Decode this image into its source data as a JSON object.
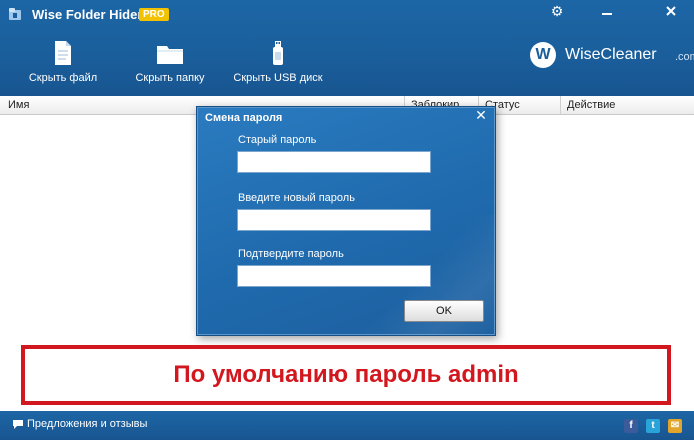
{
  "app": {
    "title": "Wise Folder Hider",
    "badge": "PRO"
  },
  "toolbar": {
    "hide_file": "Скрыть файл",
    "hide_folder": "Скрыть папку",
    "hide_usb": "Скрыть USB диск"
  },
  "brand": {
    "letter": "W",
    "name": "WiseCleaner",
    "domain": ".com"
  },
  "table": {
    "columns": [
      "Имя",
      "Заблокир.",
      "Статус",
      "Действие"
    ]
  },
  "dialog": {
    "title": "Смена пароля",
    "old_password_label": "Старый пароль",
    "old_password_value": "",
    "new_password_label": "Введите новый пароль",
    "new_password_value": "",
    "confirm_password_label": "Подтвердите пароль",
    "confirm_password_value": "",
    "ok_label": "OK",
    "close_glyph": "✕"
  },
  "note": {
    "text": "По умолчанию пароль admin"
  },
  "footer": {
    "feedback": "Предложения и отзывы",
    "social": {
      "facebook": "f",
      "twitter": "t",
      "email": "✉"
    }
  },
  "colors": {
    "header_blue": "#1a5f9c",
    "dialog_blue": "#1f6aad",
    "note_red": "#d2171f",
    "badge_yellow": "#f2c200"
  },
  "icons": [
    "app-logo-icon",
    "settings-icon",
    "minimize-icon",
    "close-icon",
    "file-icon",
    "folder-icon",
    "usb-icon",
    "chat-icon",
    "facebook-icon",
    "twitter-icon",
    "email-icon"
  ]
}
